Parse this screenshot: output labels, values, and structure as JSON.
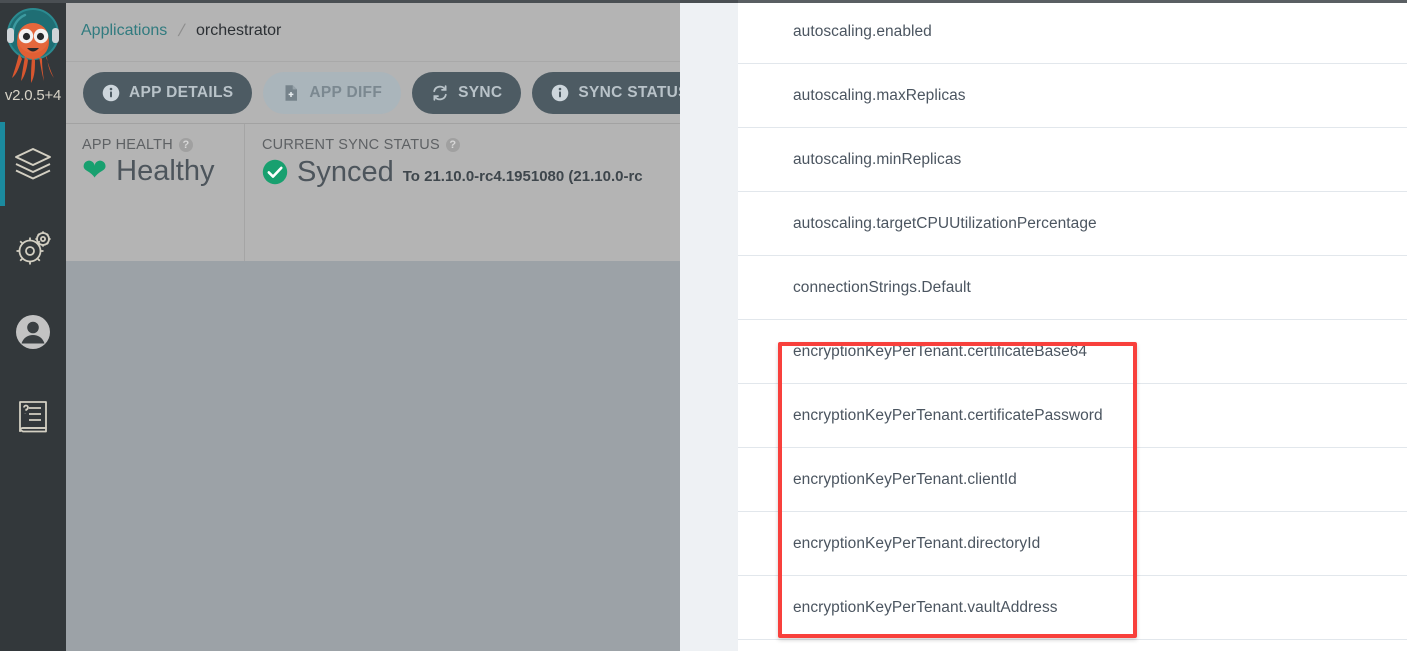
{
  "nav": {
    "version_label": "v2.0.5+4",
    "items": [
      {
        "name": "applications",
        "icon": "layers-icon",
        "active": true
      },
      {
        "name": "settings",
        "icon": "gear-icon",
        "active": false
      },
      {
        "name": "user-info",
        "icon": "user-icon",
        "active": false
      },
      {
        "name": "documentation",
        "icon": "book-icon",
        "active": false
      }
    ]
  },
  "breadcrumb": {
    "root": "Applications",
    "separator": "/",
    "current": "orchestrator"
  },
  "toolbar": {
    "buttons": [
      {
        "label": "APP DETAILS",
        "icon": "info-icon",
        "style": "solid"
      },
      {
        "label": "APP DIFF",
        "icon": "file-diff-icon",
        "style": "muted"
      },
      {
        "label": "SYNC",
        "icon": "sync-icon",
        "style": "solid"
      },
      {
        "label": "SYNC STATUS",
        "icon": "info-icon",
        "style": "solid"
      },
      {
        "label": "",
        "icon": "history-rollback-icon",
        "style": "solid"
      }
    ]
  },
  "status": {
    "health": {
      "caption": "APP HEALTH",
      "help": "?",
      "icon": "heart-icon",
      "value": "Healthy"
    },
    "sync": {
      "caption": "CURRENT SYNC STATUS",
      "help": "?",
      "icon": "check-circle-icon",
      "value": "Synced",
      "detail": "To 21.10.0-rc4.1951080 (21.10.0-rc"
    }
  },
  "panel": {
    "rows": [
      {
        "label": "autoscaling.enabled"
      },
      {
        "label": "autoscaling.maxReplicas"
      },
      {
        "label": "autoscaling.minReplicas"
      },
      {
        "label": "autoscaling.targetCPUUtilizationPercentage"
      },
      {
        "label": "connectionStrings.Default"
      },
      {
        "label": "encryptionKeyPerTenant.certificateBase64"
      },
      {
        "label": "encryptionKeyPerTenant.certificatePassword"
      },
      {
        "label": "encryptionKeyPerTenant.clientId"
      },
      {
        "label": "encryptionKeyPerTenant.directoryId"
      },
      {
        "label": "encryptionKeyPerTenant.vaultAddress"
      }
    ]
  },
  "annotation": {
    "highlight_color": "#f8403c",
    "highlighted_rows": [
      "encryptionKeyPerTenant.certificateBase64",
      "encryptionKeyPerTenant.certificatePassword",
      "encryptionKeyPerTenant.clientId",
      "encryptionKeyPerTenant.directoryId",
      "encryptionKeyPerTenant.vaultAddress"
    ]
  },
  "colors": {
    "nav_background": "#33383b",
    "nav_accent": "#1b8a9e",
    "overlay_dim": "#9ca2a7",
    "header_band": "#b4b4b4",
    "link": "#317b7f",
    "healthy_green": "#18a06f",
    "synced_green": "#18a06f",
    "panel_background": "#ffffff"
  }
}
